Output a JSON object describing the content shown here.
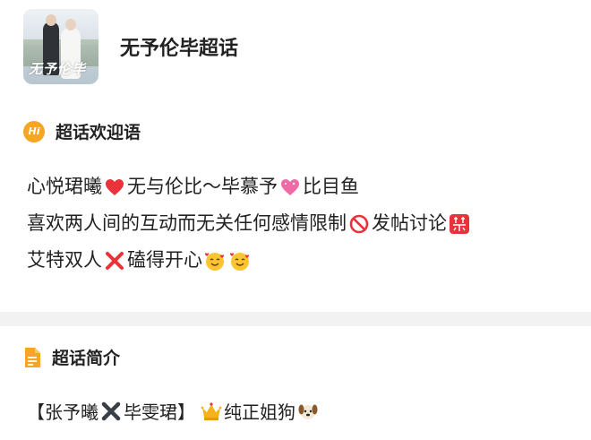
{
  "header": {
    "topic_title": "无予伦毕超话",
    "cover_title": "无予伦毕",
    "cover_icon": "topic-cover-image"
  },
  "welcome_section": {
    "title": "超话欢迎语",
    "icon": "hi-icon",
    "icon_text": "Hi",
    "lines": [
      {
        "a": "心悦珺曦",
        "b": "无与伦比～毕慕予",
        "c": "比目鱼"
      },
      {
        "a": "喜欢两人间的互动而无关任何感情限制",
        "b": "发帖讨论"
      },
      {
        "a": "艾特双人",
        "b": "磕得开心"
      }
    ]
  },
  "intro_section": {
    "title": "超话简介",
    "icon": "document-icon",
    "text_a": "【张予曦",
    "text_b": "毕雯珺】",
    "text_c": "纯正姐狗"
  },
  "colors": {
    "accent_orange": "#f5a623",
    "heart_red": "#e8333a",
    "heart_pink": "#f06ba5",
    "band_gray": "#f2f2f2"
  }
}
